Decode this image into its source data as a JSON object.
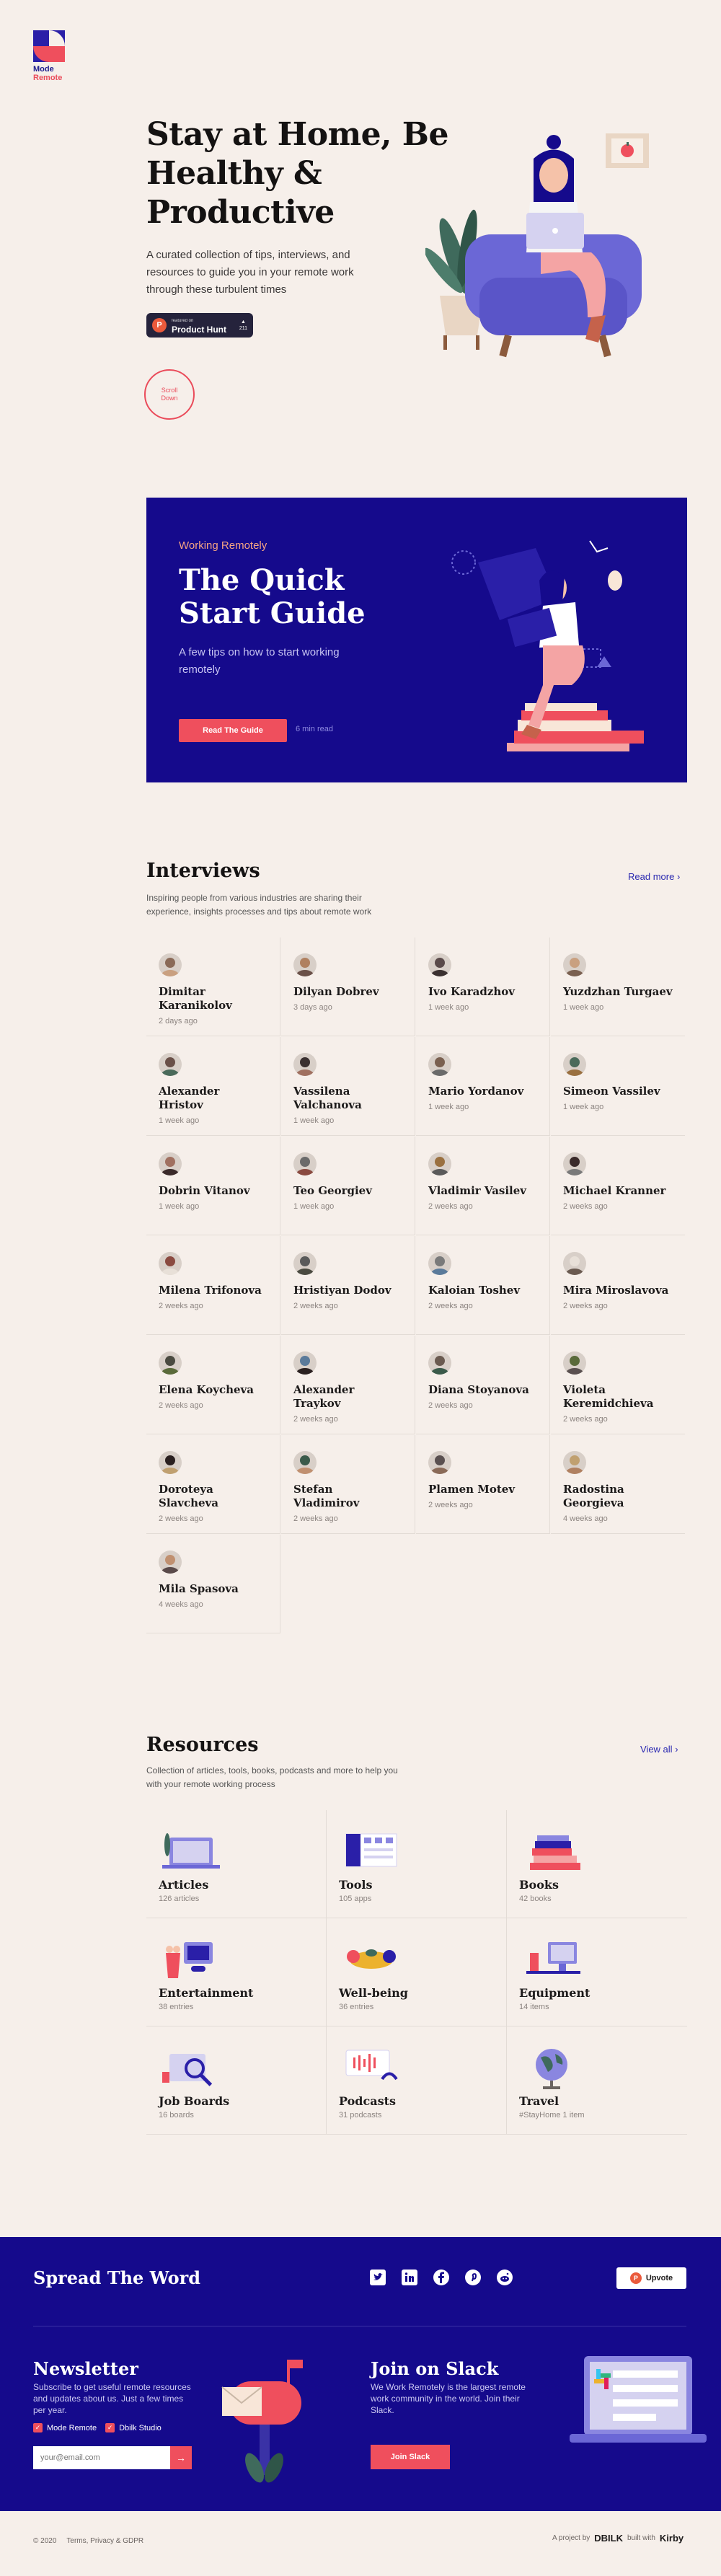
{
  "logo": {
    "line1": "Mode",
    "line2": "Remote"
  },
  "hero": {
    "title": "Stay at Home, Be Healthy & Productive",
    "subtitle": "A curated collection of tips, interviews, and resources to guide you in your remote work through these turbulent times",
    "badge_small": "featured on",
    "badge_big": "Product Hunt",
    "badge_count": "211",
    "scroll_label": "Scroll Down"
  },
  "quickstart": {
    "eyebrow": "Working Remotely",
    "title": "The Quick Start Guide",
    "description": "A few tips on how to start working remotely",
    "button": "Read The Guide",
    "meta": "6 min read"
  },
  "interviews": {
    "title": "Interviews",
    "description": "Inspiring people from various industries are sharing their experience, insights processes and tips about remote work",
    "link": "Read more",
    "items": [
      {
        "name": "Dimitar Karanikolov",
        "time": "2 days ago"
      },
      {
        "name": "Dilyan Dobrev",
        "time": "3 days ago"
      },
      {
        "name": "Ivo Karadzhov",
        "time": "1 week ago"
      },
      {
        "name": "Yuzdzhan Turgaev",
        "time": "1 week ago"
      },
      {
        "name": "Alexander Hristov",
        "time": "1 week ago"
      },
      {
        "name": "Vassilena Valchanova",
        "time": "1 week ago"
      },
      {
        "name": "Mario Yordanov",
        "time": "1 week ago"
      },
      {
        "name": "Simeon Vassilev",
        "time": "1 week ago"
      },
      {
        "name": "Dobrin Vitanov",
        "time": "1 week ago"
      },
      {
        "name": "Teo Georgiev",
        "time": "1 week ago"
      },
      {
        "name": "Vladimir Vasilev",
        "time": "2 weeks ago"
      },
      {
        "name": "Michael Kranner",
        "time": "2 weeks ago"
      },
      {
        "name": "Milena Trifonova",
        "time": "2 weeks ago"
      },
      {
        "name": "Hristiyan Dodov",
        "time": "2 weeks ago"
      },
      {
        "name": "Kaloian Toshev",
        "time": "2 weeks ago"
      },
      {
        "name": "Mira Miroslavova",
        "time": "2 weeks ago"
      },
      {
        "name": "Elena Koycheva",
        "time": "2 weeks ago"
      },
      {
        "name": "Alexander Traykov",
        "time": "2 weeks ago"
      },
      {
        "name": "Diana Stoyanova",
        "time": "2 weeks ago"
      },
      {
        "name": "Violeta Keremidchieva",
        "time": "2 weeks ago"
      },
      {
        "name": "Doroteya Slavcheva",
        "time": "2 weeks ago"
      },
      {
        "name": "Stefan Vladimirov",
        "time": "2 weeks ago"
      },
      {
        "name": "Plamen Motev",
        "time": "2 weeks ago"
      },
      {
        "name": "Radostina Georgieva",
        "time": "4 weeks ago"
      },
      {
        "name": "Mila Spasova",
        "time": "4 weeks ago"
      }
    ]
  },
  "resources": {
    "title": "Resources",
    "description": "Collection of articles, tools, books, podcasts and more to help you with your remote working process",
    "link": "View all",
    "items": [
      {
        "name": "Articles",
        "count": "126 articles"
      },
      {
        "name": "Tools",
        "count": "105 apps"
      },
      {
        "name": "Books",
        "count": "42 books"
      },
      {
        "name": "Entertainment",
        "count": "38 entries"
      },
      {
        "name": "Well-being",
        "count": "36 entries"
      },
      {
        "name": "Equipment",
        "count": "14 items"
      },
      {
        "name": "Job Boards",
        "count": "16 boards"
      },
      {
        "name": "Podcasts",
        "count": "31 podcasts"
      },
      {
        "name": "Travel",
        "count": "#StayHome 1 item"
      }
    ]
  },
  "footer": {
    "spread": "Spread The Word",
    "upvote": "Upvote",
    "newsletter_title": "Newsletter",
    "newsletter_desc": "Subscribe to get useful remote resources and updates about us. Just a few times per year.",
    "check1": "Mode Remote",
    "check2": "Dbilk Studio",
    "email_placeholder": "your@email.com",
    "slack_title": "Join on Slack",
    "slack_desc": "We Work Remotely is the largest remote work community in the world. Join their Slack.",
    "slack_button": "Join Slack",
    "copyright": "© 2020",
    "terms": "Terms, Privacy & GDPR",
    "project_by": "A project by",
    "studio": "DBILK",
    "built_with": "built with",
    "kirby": "Kirby"
  },
  "colors": {
    "accent": "#ef4f5d",
    "navy": "#150a8c",
    "background": "#f6efea"
  }
}
